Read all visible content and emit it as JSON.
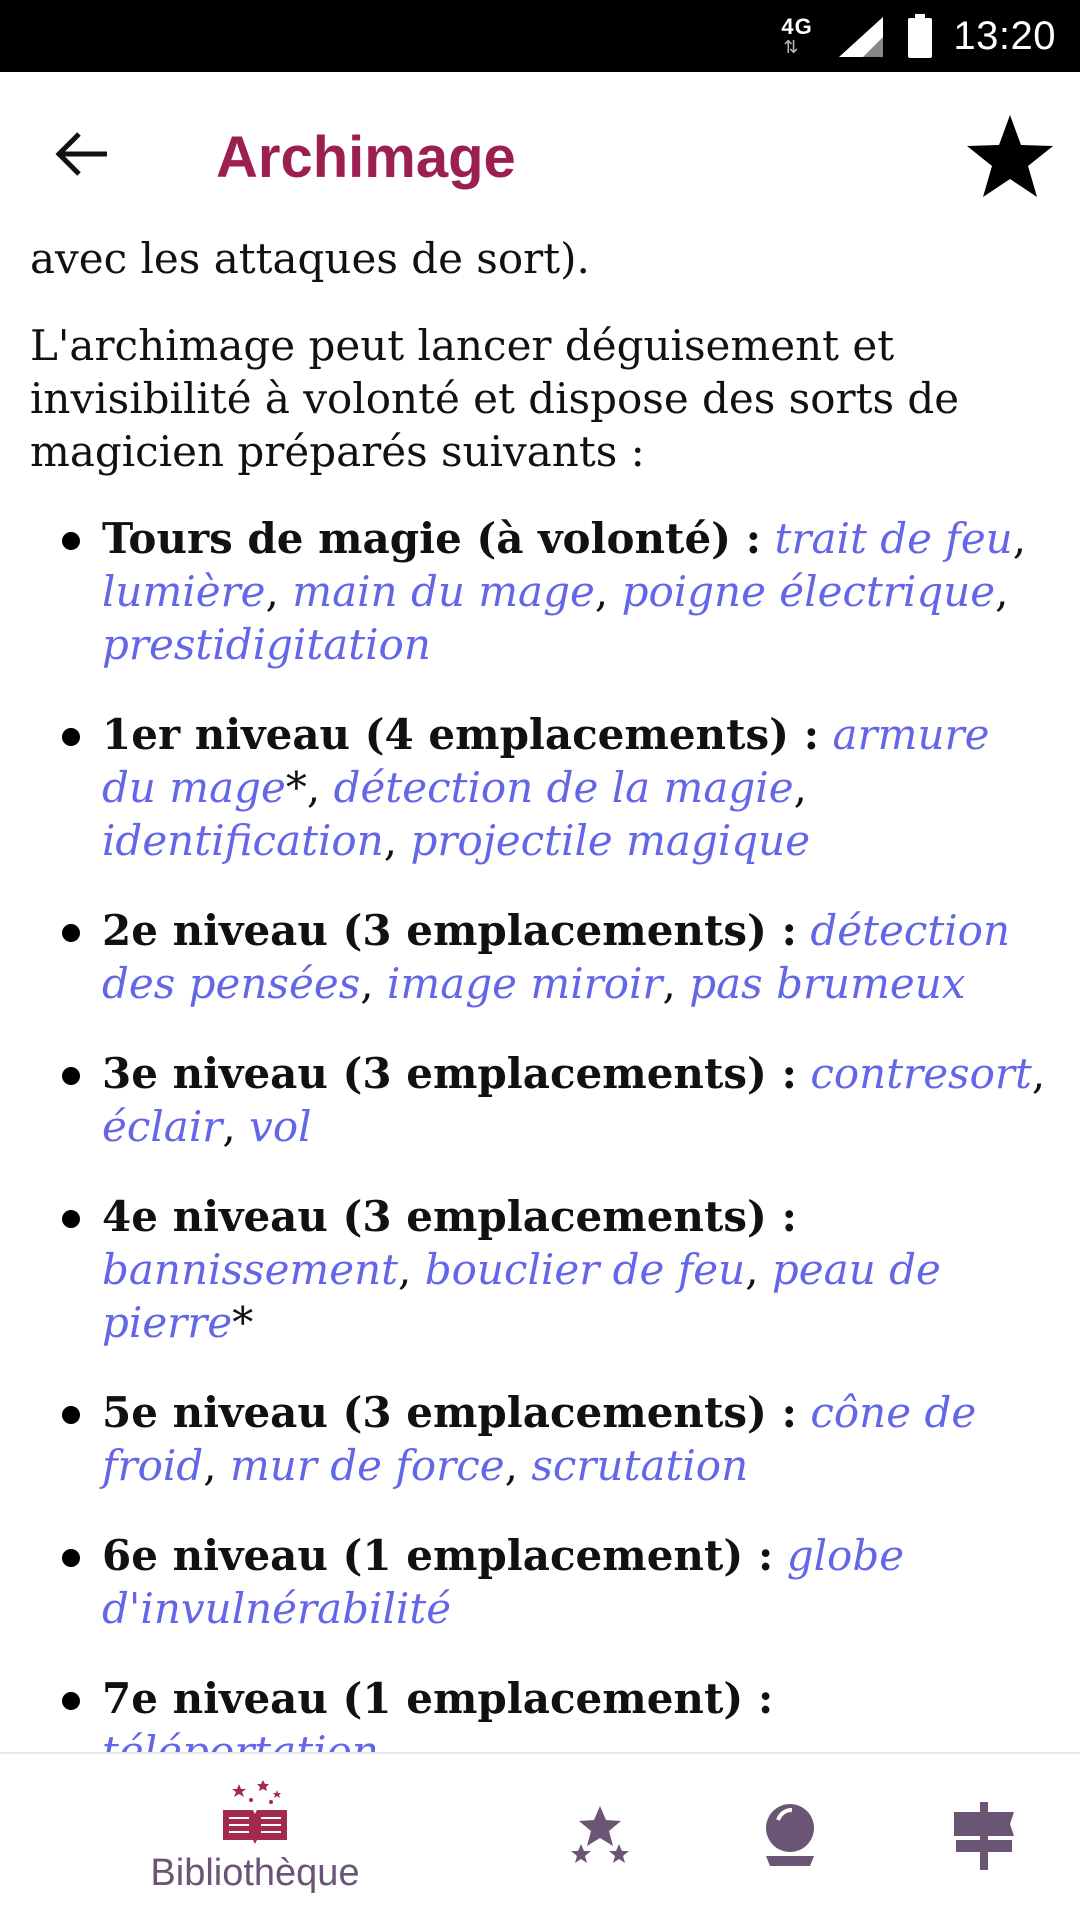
{
  "status_bar": {
    "network": "4G",
    "time": "13:20"
  },
  "app_bar": {
    "title": "Archimage"
  },
  "content": {
    "intro_tail": "avec les attaques de sort).",
    "paragraph": "L'archimage peut lancer déguisement et invisibilité à volonté et dispose des sorts de magicien préparés suivants :",
    "spell_levels": [
      {
        "level": "Tours de magie (à volonté) :",
        "spells": [
          {
            "name": "trait de feu",
            "suffix": ","
          },
          {
            "name": "lumière",
            "suffix": ","
          },
          {
            "name": "main du mage",
            "suffix": ","
          },
          {
            "name": "poigne électrique",
            "suffix": ","
          },
          {
            "name": "prestidigitation",
            "suffix": ""
          }
        ]
      },
      {
        "level": "1er niveau (4 emplacements) :",
        "spells": [
          {
            "name": "armure du mage",
            "suffix": "*,"
          },
          {
            "name": "détection de la magie",
            "suffix": ","
          },
          {
            "name": "identification",
            "suffix": ","
          },
          {
            "name": "projectile magique",
            "suffix": ""
          }
        ]
      },
      {
        "level": "2e niveau (3 emplacements) :",
        "spells": [
          {
            "name": "détection des pensées",
            "suffix": ","
          },
          {
            "name": "image miroir",
            "suffix": ","
          },
          {
            "name": "pas brumeux",
            "suffix": ""
          }
        ]
      },
      {
        "level": "3e niveau (3 emplacements) :",
        "spells": [
          {
            "name": "contresort",
            "suffix": ","
          },
          {
            "name": "éclair",
            "suffix": ","
          },
          {
            "name": "vol",
            "suffix": ""
          }
        ]
      },
      {
        "level": "4e niveau (3 emplacements) :",
        "spells": [
          {
            "name": "bannissement",
            "suffix": ","
          },
          {
            "name": "bouclier de feu",
            "suffix": ","
          },
          {
            "name": "peau de pierre",
            "suffix": "*"
          }
        ]
      },
      {
        "level": "5e niveau (3 emplacements) :",
        "spells": [
          {
            "name": "cône de froid",
            "suffix": ","
          },
          {
            "name": "mur de force",
            "suffix": ","
          },
          {
            "name": "scrutation",
            "suffix": ""
          }
        ]
      },
      {
        "level": "6e niveau (1 emplacement) :",
        "spells": [
          {
            "name": "globe d'invulnérabilité",
            "suffix": ""
          }
        ]
      },
      {
        "level": "7e niveau (1 emplacement) :",
        "spells": [
          {
            "name": "téléportation",
            "suffix": ""
          }
        ]
      }
    ]
  },
  "bottom_nav": {
    "library_label": "Bibliothèque",
    "active": "library"
  },
  "colors": {
    "title": "#9b1f4f",
    "link": "#6366e6",
    "nav_icon": "#6a5674",
    "nav_active": "#a32a4e"
  },
  "icons": [
    "back-arrow-icon",
    "star-icon",
    "book-icon",
    "stars-icon",
    "crystal-ball-icon",
    "signpost-icon"
  ]
}
